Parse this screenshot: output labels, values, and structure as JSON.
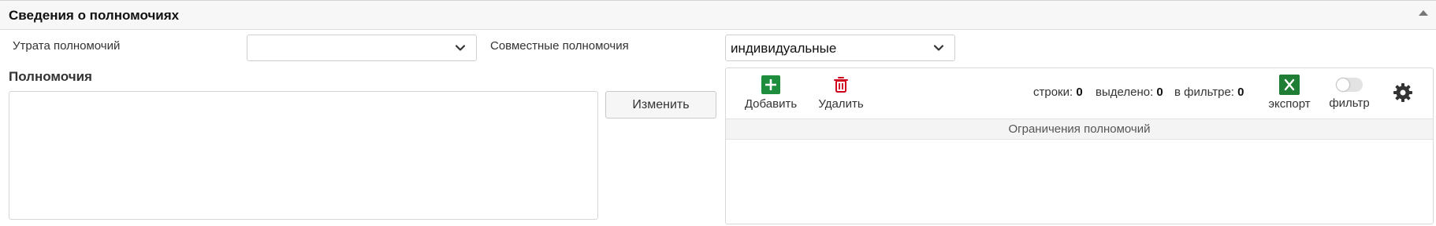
{
  "header": {
    "title": "Сведения о полномочиях"
  },
  "form": {
    "loss_label": "Утрата полномочий",
    "loss_value": "",
    "joint_label": "Совместные полномочия",
    "joint_value": "индивидуальные",
    "powers_label": "Полномочия",
    "powers_value": "",
    "change_button": "Изменить"
  },
  "grid": {
    "add_label": "Добавить",
    "delete_label": "Удалить",
    "rows_label": "строки:",
    "rows_value": "0",
    "selected_label": "выделено:",
    "selected_value": "0",
    "filtered_label": "в фильтре:",
    "filtered_value": "0",
    "export_label": "экспорт",
    "filter_label": "фильтр",
    "column_header": "Ограничения полномочий",
    "filter_enabled": false
  },
  "icons": {
    "add": "plus-icon",
    "delete": "trash-icon",
    "export": "excel-icon",
    "settings": "gear-icon",
    "collapse": "triangle-up-icon",
    "dropdown": "chevron-down-icon"
  },
  "colors": {
    "add": "#1e8e3e",
    "delete": "#d0021b",
    "export": "#1e7e34",
    "header_bg": "#f7f7f7"
  }
}
